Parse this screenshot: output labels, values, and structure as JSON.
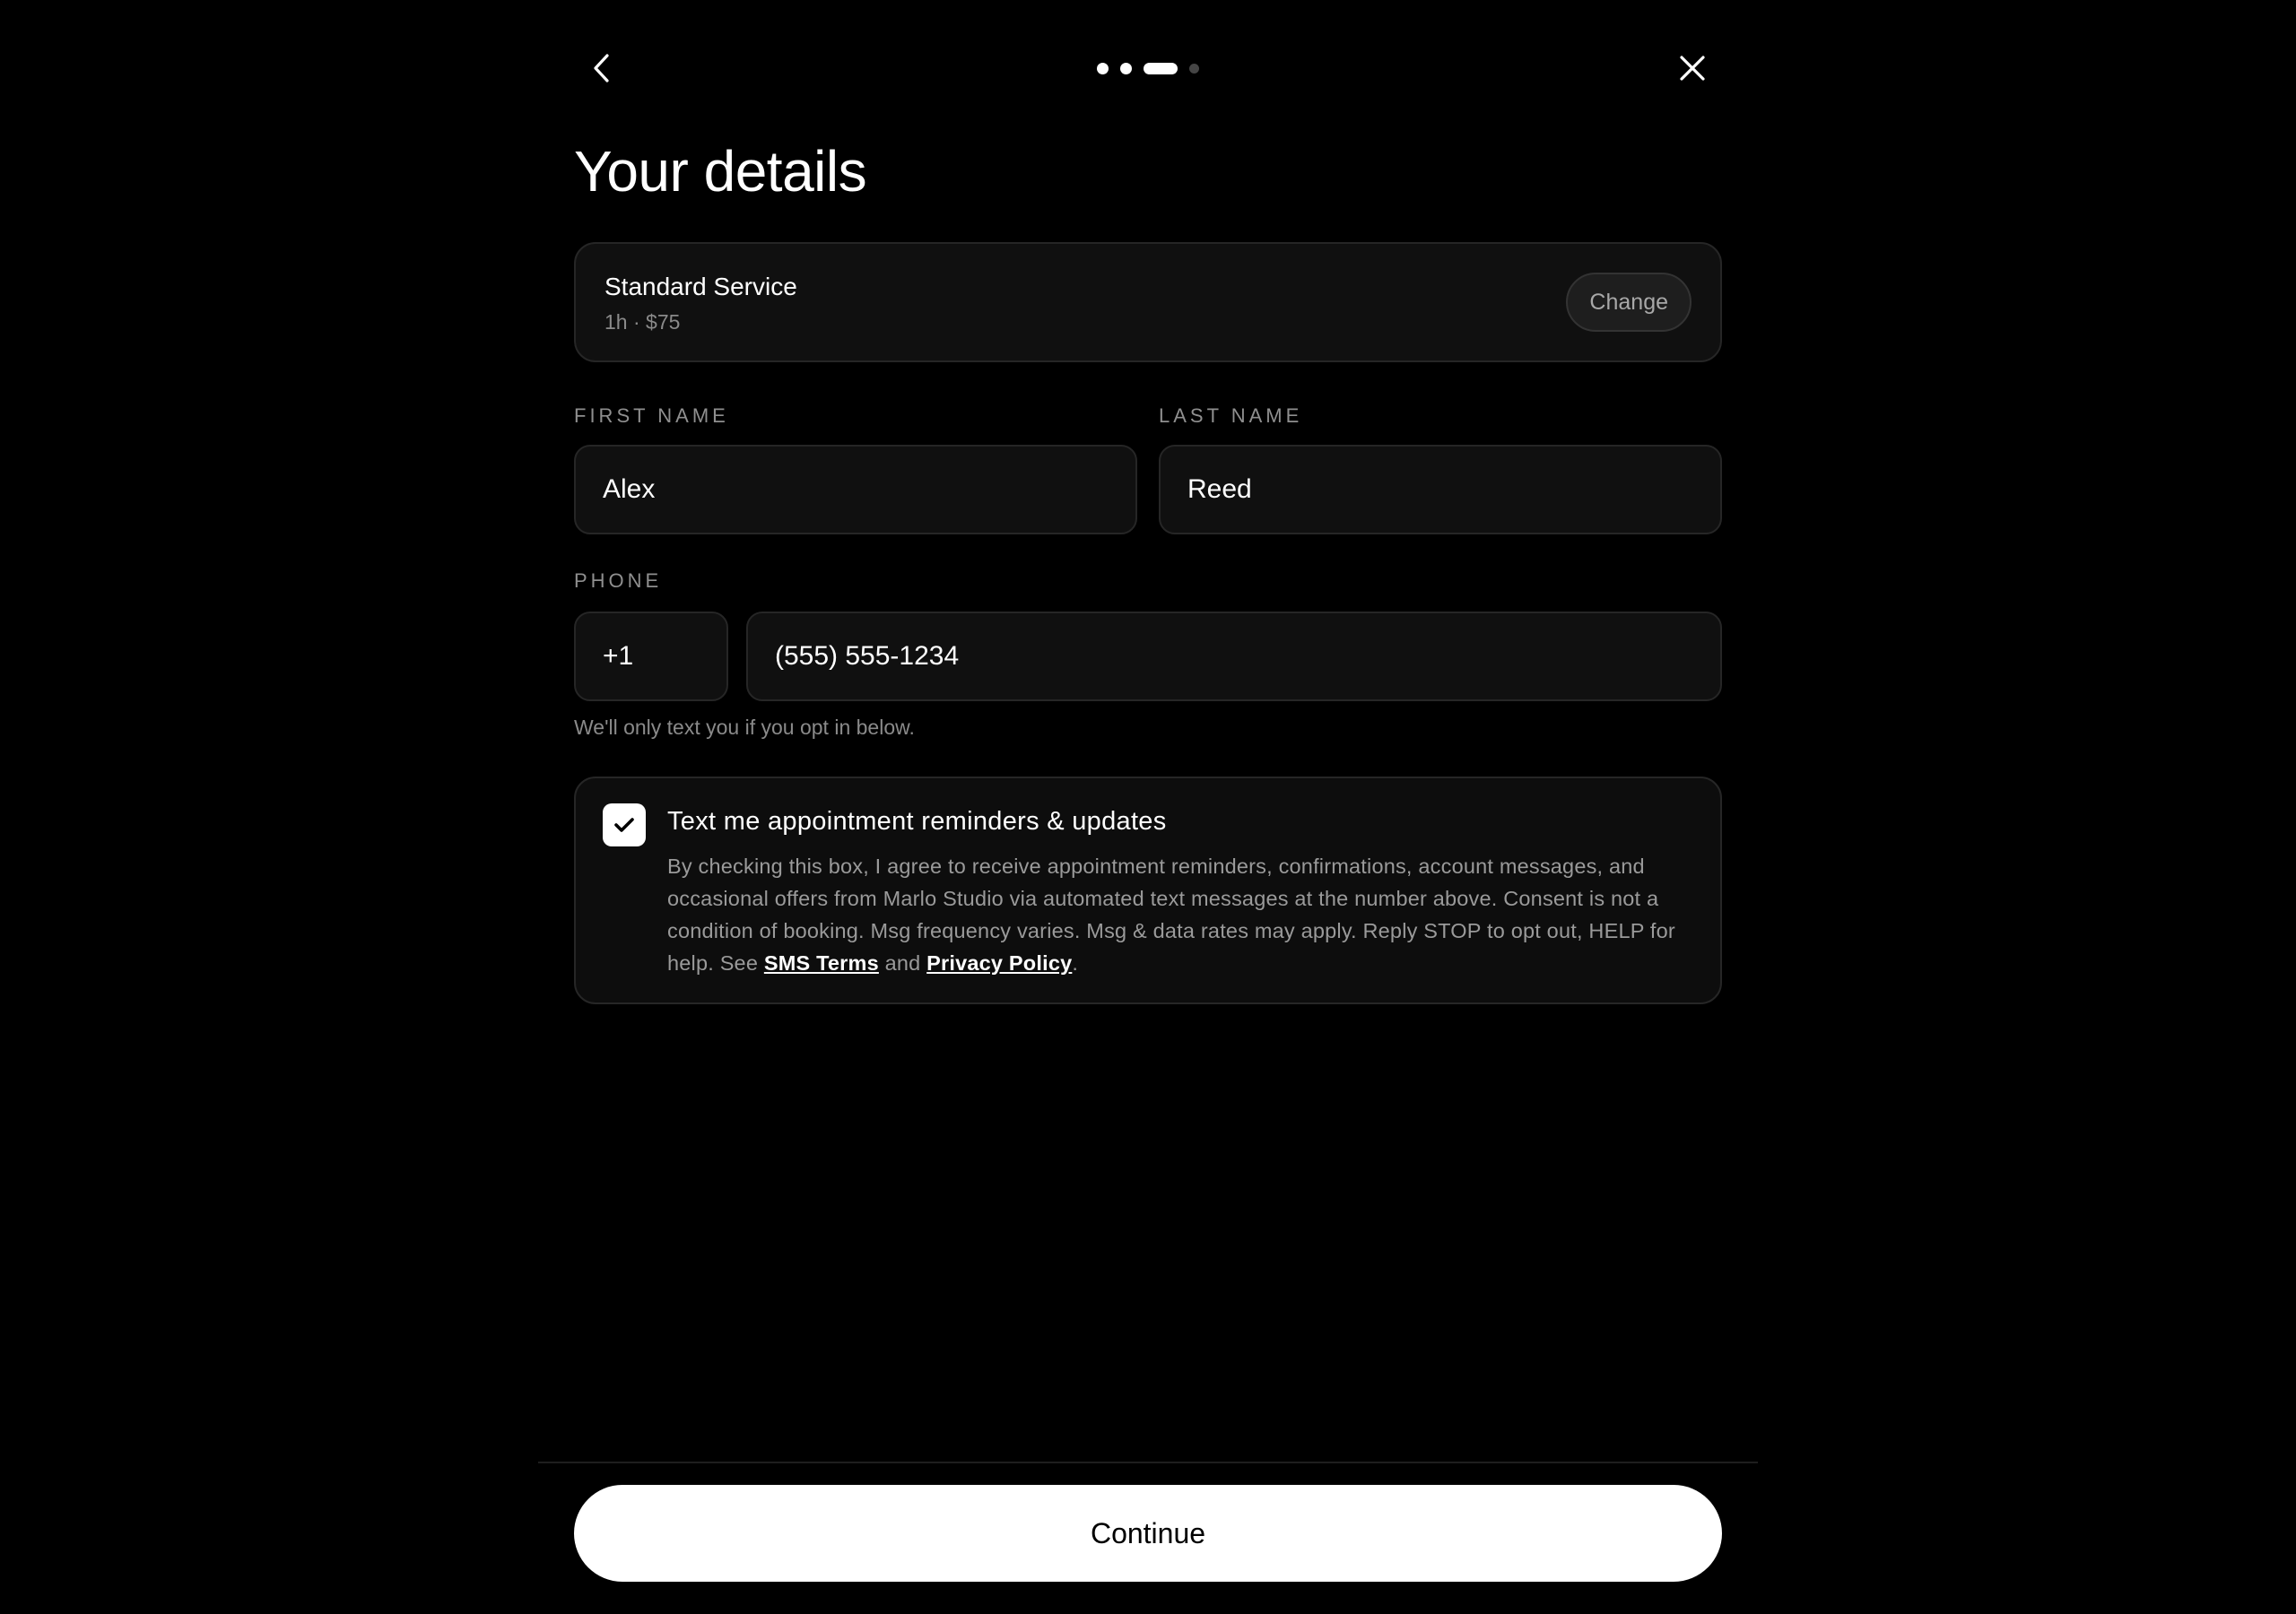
{
  "header": {
    "back_icon": "chevron-left-icon",
    "close_icon": "close-icon",
    "stepper": {
      "total_steps": 4,
      "current_step": 3
    }
  },
  "page": {
    "title": "Your details"
  },
  "service": {
    "name": "Standard Service",
    "meta": "1h · $75",
    "change_label": "Change"
  },
  "form": {
    "first_name": {
      "label": "FIRST NAME",
      "value": "Alex"
    },
    "last_name": {
      "label": "LAST NAME",
      "value": "Reed"
    },
    "phone": {
      "label": "PHONE",
      "country_code": "+1",
      "value": "(555) 555-1234",
      "hint": "We'll only text you if you opt in below."
    }
  },
  "consent": {
    "checked": true,
    "check_icon": "checkmark-icon",
    "title": "Text me appointment reminders & updates",
    "text_before": "By checking this box, I agree to receive appointment reminders, confirmations, account messages, and occasional offers from Marlo Studio via automated text messages at the number above. Consent is not a condition of booking. Msg frequency varies. Msg & data rates may apply. Reply STOP to opt out, HELP for help. See ",
    "sms_terms_link": "SMS Terms",
    "text_between": " and ",
    "privacy_link": "Privacy Policy",
    "text_after": "."
  },
  "footer": {
    "continue_label": "Continue"
  },
  "colors": {
    "background": "#000000",
    "surface": "#101010",
    "border": "#262626",
    "primary_button": "#ffffff",
    "muted_text": "#8a8a8a"
  }
}
